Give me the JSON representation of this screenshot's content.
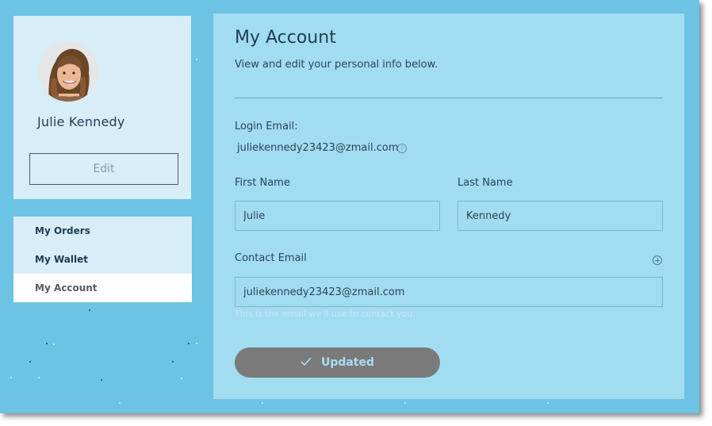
{
  "profile": {
    "name": "Julie Kennedy",
    "edit_label": "Edit"
  },
  "menu": {
    "items": [
      {
        "label": "My Orders"
      },
      {
        "label": "My Wallet"
      },
      {
        "label": "My Account"
      }
    ]
  },
  "account": {
    "title": "My Account",
    "subtitle": "View and edit your personal info below.",
    "login_email_label": "Login Email:",
    "login_email": "juliekennedy23423@zmail.com",
    "first_name_label": "First Name",
    "first_name": "Julie",
    "last_name_label": "Last Name",
    "last_name": "Kennedy",
    "contact_email_label": "Contact Email",
    "contact_email": "juliekennedy23423@zmail.com",
    "contact_email_help": "This is the email we'll use to contact you.",
    "submit_label": "Updated"
  },
  "icons": {
    "info": "info-icon",
    "add": "plus-circle-icon",
    "check": "check-icon"
  },
  "colors": {
    "background": "#6cc3e3",
    "panel": "#a2dcf1",
    "card": "#d7eef9",
    "text_dark": "#1e3d52",
    "button_disabled": "#7a7a7a"
  }
}
